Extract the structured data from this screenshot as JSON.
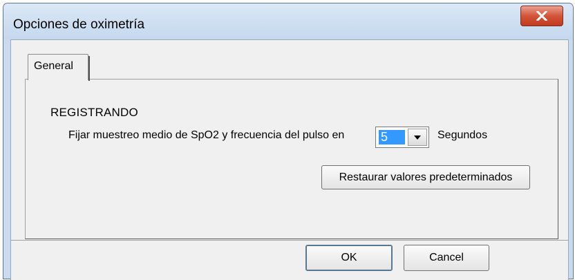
{
  "window": {
    "title": "Opciones de oximetría",
    "close_icon": "close-x-icon"
  },
  "tabs": [
    {
      "label": "General",
      "selected": true
    }
  ],
  "general": {
    "section_heading": "REGISTRANDO",
    "sample_label": "Fijar muestreo medio de SpO2 y frecuencia del pulso en",
    "sample_value": "5",
    "units_label": "Segundos",
    "restore_button": "Restaurar valores predeterminados"
  },
  "footer": {
    "ok_label": "OK",
    "cancel_label": "Cancel"
  },
  "colors": {
    "selection": "#3399ff",
    "close_button": "#c8472c",
    "frame": "#c9dcef"
  }
}
